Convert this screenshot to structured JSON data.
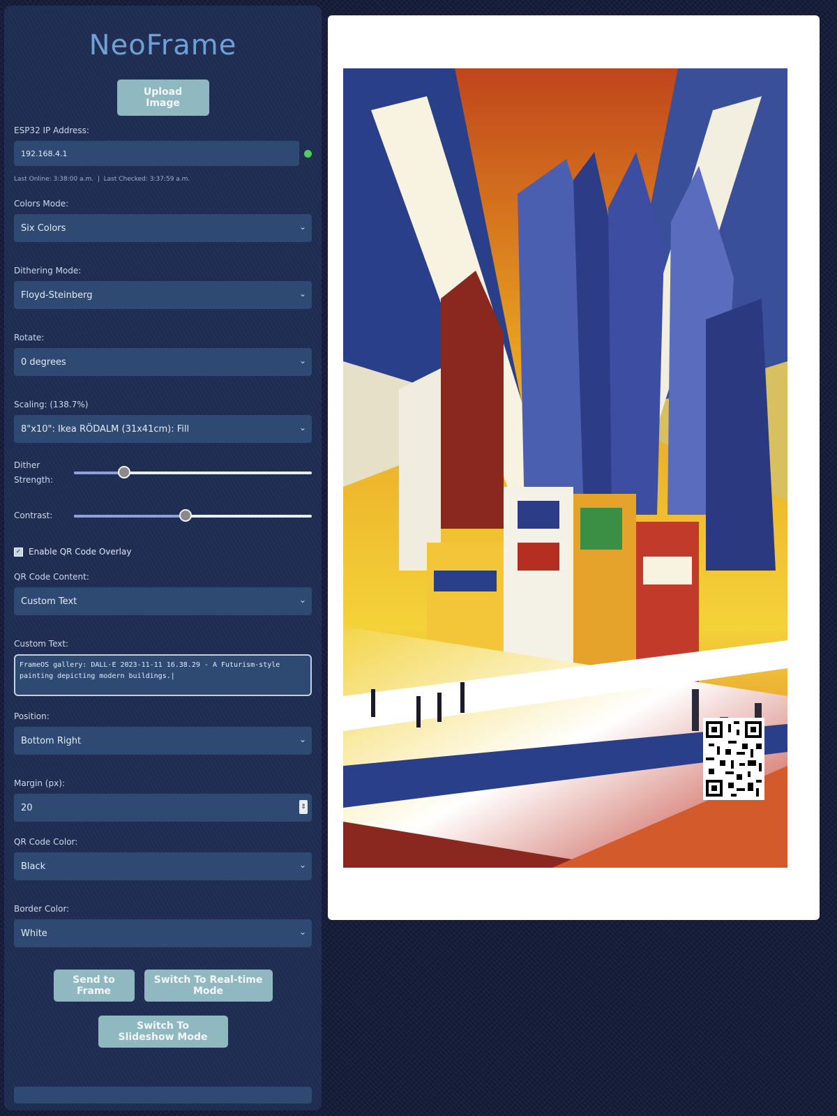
{
  "app": {
    "title": "NeoFrame"
  },
  "upload": {
    "label": "Upload Image"
  },
  "ip": {
    "label": "ESP32 IP Address:",
    "value": "192.168.4.1",
    "status_color": "#4fcf5a"
  },
  "status": {
    "last_online": "Last Online: 3:38:00 a.m.",
    "separator": "|",
    "last_checked": "Last Checked: 3:37:59 a.m."
  },
  "colors_mode": {
    "label": "Colors Mode:",
    "value": "Six Colors"
  },
  "dithering_mode": {
    "label": "Dithering Mode:",
    "value": "Floyd-Steinberg"
  },
  "rotate": {
    "label": "Rotate:",
    "value": "0 degrees"
  },
  "scaling": {
    "label": "Scaling: (138.7%)",
    "value": "8\"x10\": Ikea RÖDALM (31x41cm): Fill"
  },
  "dither_strength": {
    "label": "Dither Strength:",
    "value_fraction": 0.21
  },
  "contrast": {
    "label": "Contrast:",
    "value_fraction": 0.47
  },
  "qr_overlay": {
    "label": "Enable QR Code Overlay",
    "checked": true
  },
  "qr_content": {
    "label": "QR Code Content:",
    "value": "Custom Text"
  },
  "custom_text": {
    "label": "Custom Text:",
    "value": "FrameOS gallery: DALL·E 2023-11-11 16.38.29 - A Futurism-style painting depicting modern buildings.|"
  },
  "position": {
    "label": "Position:",
    "value": "Bottom Right"
  },
  "margin": {
    "label": "Margin (px):",
    "value": "20"
  },
  "qr_color": {
    "label": "QR Code Color:",
    "value": "Black"
  },
  "border_color": {
    "label": "Border Color:",
    "value": "White"
  },
  "actions": {
    "send": "Send to Frame",
    "realtime": "Switch To Real-time Mode",
    "slideshow": "Switch To Slideshow Mode"
  },
  "icons": {
    "select_chevron": "chevron-down-icon",
    "checkbox_check": "check-icon"
  },
  "theme": {
    "accent": "#6fa0d6",
    "button": "#8fb8c0",
    "panel": "#1e2c52",
    "field": "#2e4a72"
  }
}
